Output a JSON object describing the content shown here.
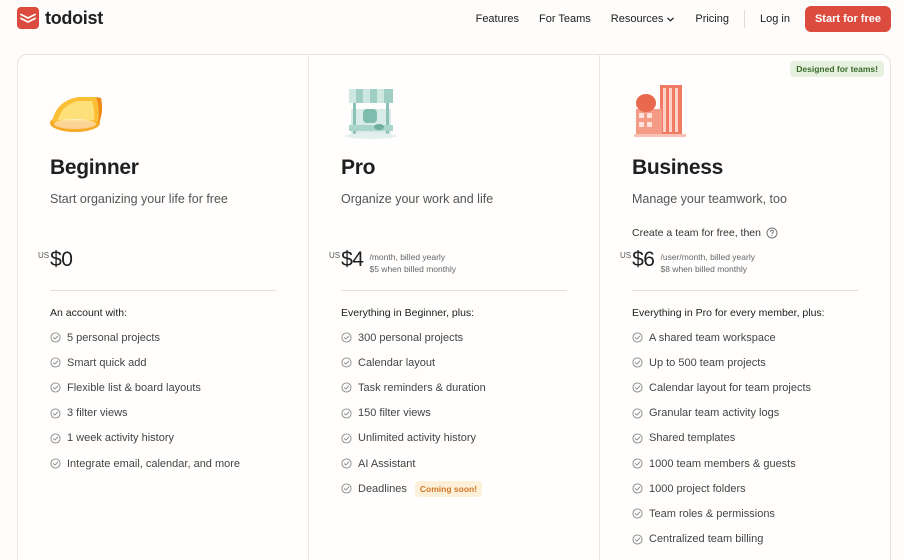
{
  "header": {
    "logo_text": "todoist",
    "nav": {
      "features": "Features",
      "for_teams": "For Teams",
      "resources": "Resources",
      "pricing": "Pricing",
      "login": "Log in",
      "cta": "Start for free"
    }
  },
  "colors": {
    "brand": "#dc4c3e",
    "coming_soon_bg": "#fdf0d9",
    "coming_soon_text": "#d1772a",
    "teams_badge_bg": "#e5f0de",
    "teams_badge_text": "#3c6b2b"
  },
  "plans": [
    {
      "name": "Beginner",
      "description": "Start organizing your life for free",
      "currency": "US",
      "price": "$0",
      "features_heading": "An account with:",
      "features": [
        "5 personal projects",
        "Smart quick add",
        "Flexible list & board layouts",
        "3 filter views",
        "1 week activity history",
        "Integrate email, calendar, and more"
      ]
    },
    {
      "name": "Pro",
      "description": "Organize your work and life",
      "currency": "US",
      "price": "$4",
      "billing_line1": "/month, billed yearly",
      "billing_line2": "$5 when billed monthly",
      "features_heading": "Everything in Beginner, plus:",
      "features": [
        "300 personal projects",
        "Calendar layout",
        "Task reminders & duration",
        "150 filter views",
        "Unlimited activity history",
        "AI Assistant",
        "Deadlines"
      ],
      "coming_soon": "Coming soon!"
    },
    {
      "name": "Business",
      "description": "Manage your teamwork, too",
      "team_note": "Create a team for free, then",
      "badge": "Designed for teams!",
      "currency": "US",
      "price": "$6",
      "billing_line1": "/user/month, billed yearly",
      "billing_line2": "$8 when billed monthly",
      "features_heading": "Everything in Pro for every member, plus:",
      "features": [
        "A shared team workspace",
        "Up to 500 team projects",
        "Calendar layout for team projects",
        "Granular team activity logs",
        "Shared templates",
        "1000 team members & guests",
        "1000 project folders",
        "Team roles & permissions",
        "Centralized team billing"
      ]
    }
  ]
}
